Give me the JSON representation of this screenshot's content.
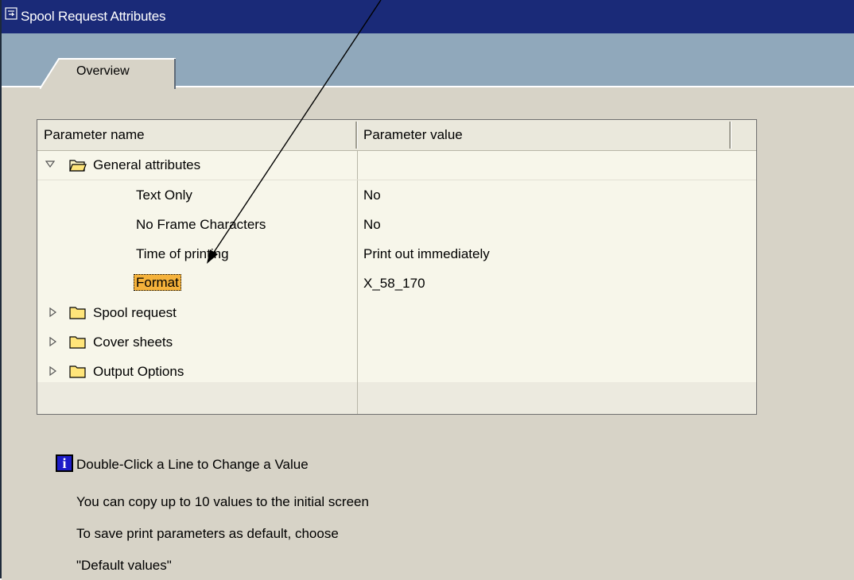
{
  "window": {
    "title": "Spool Request Attributes",
    "tab_label": "Overview"
  },
  "grid": {
    "col_name": "Parameter name",
    "col_value": "Parameter value",
    "group_general": "General attributes",
    "rows": [
      {
        "name": "Text Only",
        "value": "No"
      },
      {
        "name": "No Frame Characters",
        "value": "No"
      },
      {
        "name": "Time of printing",
        "value": "Print out immediately"
      },
      {
        "name": "Format",
        "value": "X_58_170"
      }
    ],
    "collapsed_groups": [
      "Spool request",
      "Cover sheets",
      "Output Options"
    ]
  },
  "info": {
    "line1": "Double-Click a Line to Change a Value",
    "line2": "You can copy up to 10 values to the initial screen",
    "line3": "To save print parameters as default, choose",
    "line4": "\"Default values\""
  },
  "colors": {
    "titlebar": "#1a2a78",
    "tabstrip": "#90a8bb",
    "panel": "#d7d3c7",
    "highlight": "#f5b23b"
  }
}
